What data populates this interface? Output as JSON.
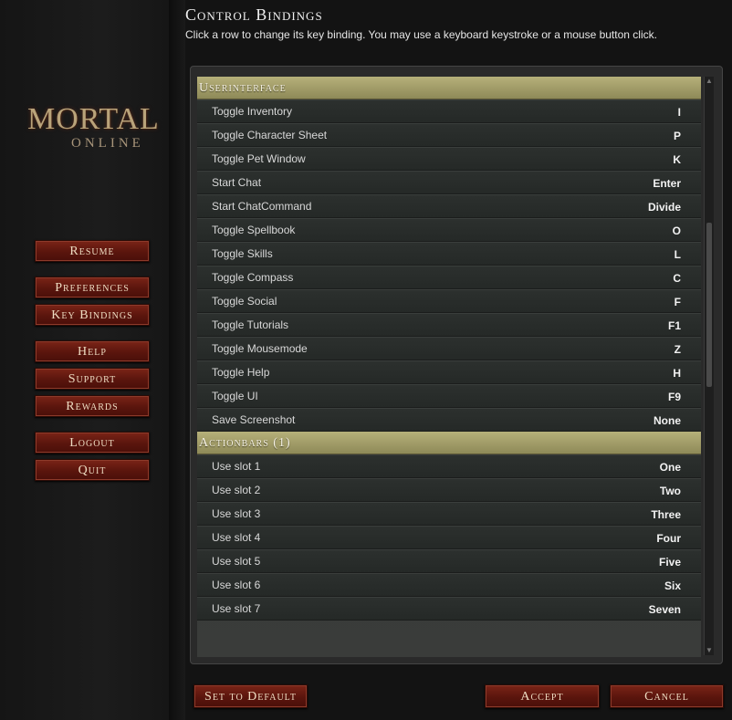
{
  "logo": {
    "top": "MORTAL",
    "bottom": "ONLINE"
  },
  "menu": {
    "resume": "Resume",
    "preferences": "Preferences",
    "key_bindings": "Key Bindings",
    "help": "Help",
    "support": "Support",
    "rewards": "Rewards",
    "logout": "Logout",
    "quit": "Quit"
  },
  "header": {
    "title": "Control Bindings",
    "subtitle": "Click a row to change its key binding.  You may use a keyboard keystroke or a mouse button click."
  },
  "sections": [
    {
      "name": "Userinterface",
      "rows": [
        {
          "action": "Toggle Inventory",
          "key": "I"
        },
        {
          "action": "Toggle Character Sheet",
          "key": "P"
        },
        {
          "action": "Toggle Pet Window",
          "key": "K"
        },
        {
          "action": "Start Chat",
          "key": "Enter"
        },
        {
          "action": "Start ChatCommand",
          "key": "Divide"
        },
        {
          "action": "Toggle Spellbook",
          "key": "O"
        },
        {
          "action": "Toggle Skills",
          "key": "L"
        },
        {
          "action": "Toggle Compass",
          "key": "C"
        },
        {
          "action": "Toggle Social",
          "key": "F"
        },
        {
          "action": "Toggle Tutorials",
          "key": "F1"
        },
        {
          "action": "Toggle Mousemode",
          "key": "Z"
        },
        {
          "action": "Toggle Help",
          "key": "H"
        },
        {
          "action": "Toggle UI",
          "key": "F9"
        },
        {
          "action": "Save Screenshot",
          "key": "None"
        }
      ]
    },
    {
      "name": "Actionbars (1)",
      "rows": [
        {
          "action": "Use slot 1",
          "key": "One"
        },
        {
          "action": "Use slot 2",
          "key": "Two"
        },
        {
          "action": "Use slot 3",
          "key": "Three"
        },
        {
          "action": "Use slot 4",
          "key": "Four"
        },
        {
          "action": "Use slot 5",
          "key": "Five"
        },
        {
          "action": "Use slot 6",
          "key": "Six"
        },
        {
          "action": "Use slot 7",
          "key": "Seven"
        }
      ]
    }
  ],
  "footer": {
    "set_default": "Set to Default",
    "accept": "Accept",
    "cancel": "Cancel"
  },
  "icons": {
    "scroll_up": "arrow-up-icon",
    "scroll_down": "arrow-down-icon"
  }
}
